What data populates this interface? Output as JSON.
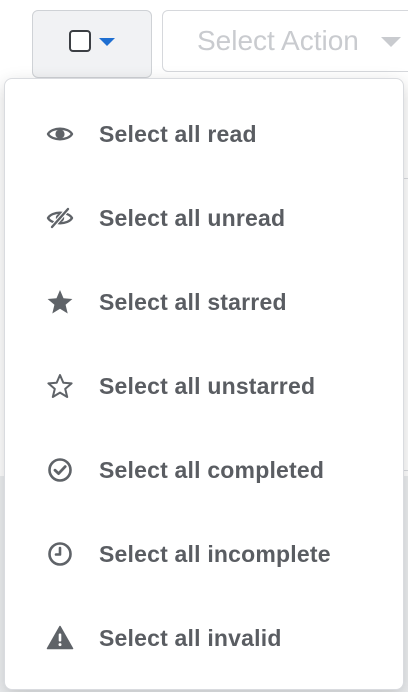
{
  "toolbar": {
    "select_action_label": "Select Action"
  },
  "dropdown": {
    "items": [
      {
        "label": "Select all read",
        "icon": "eye-icon"
      },
      {
        "label": "Select all unread",
        "icon": "eye-slash-icon"
      },
      {
        "label": "Select all starred",
        "icon": "star-filled-icon"
      },
      {
        "label": "Select all unstarred",
        "icon": "star-outline-icon"
      },
      {
        "label": "Select all completed",
        "icon": "check-circle-icon"
      },
      {
        "label": "Select all incomplete",
        "icon": "clock-icon"
      },
      {
        "label": "Select all invalid",
        "icon": "warning-icon"
      }
    ]
  },
  "colors": {
    "accent": "#1f6fd1",
    "icon": "#5f6368",
    "label": "#5a5d62",
    "placeholder": "#c9cbcf"
  }
}
